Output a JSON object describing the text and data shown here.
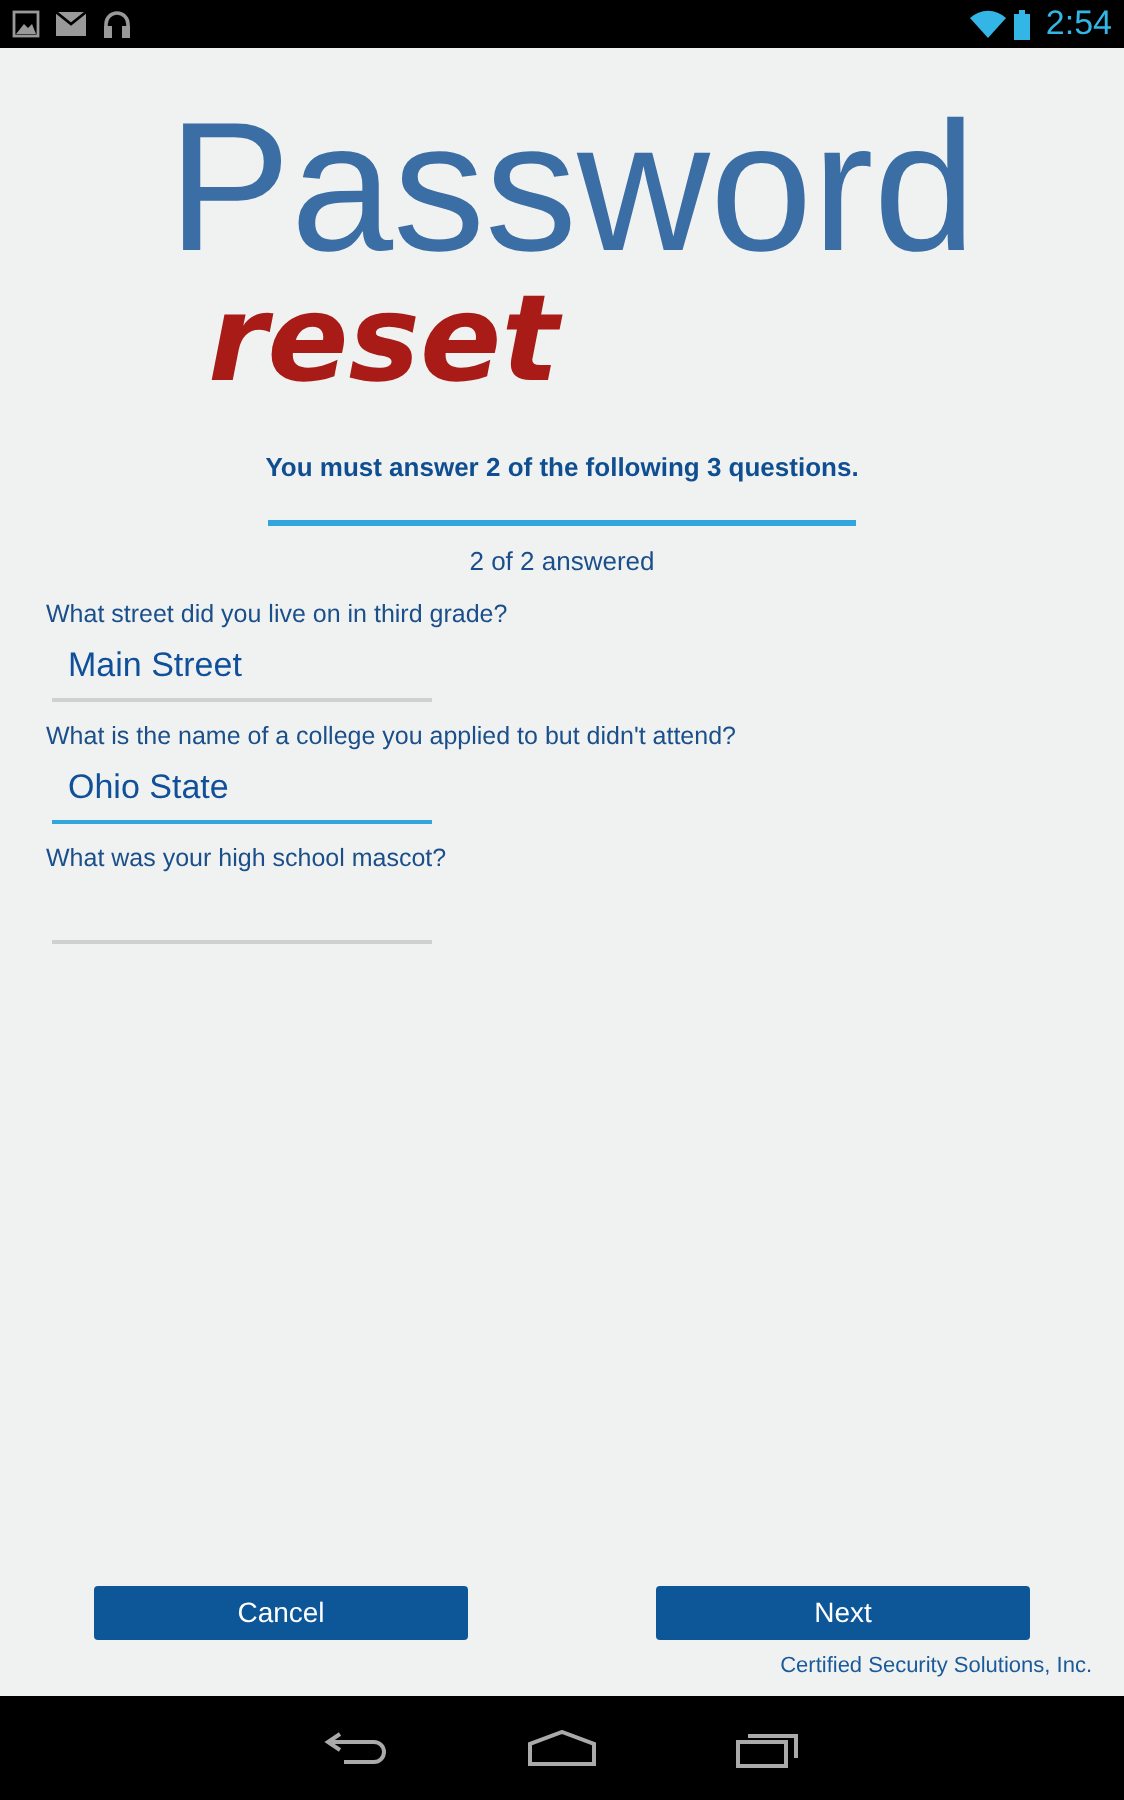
{
  "status_bar": {
    "time": "2:54"
  },
  "logo": {
    "title": "Password",
    "subtitle": "reset"
  },
  "instruction": "You must answer 2 of the following 3 questions.",
  "progress": {
    "level": 1,
    "caption": "2 of 2 answered"
  },
  "questions": [
    {
      "label": "What street did you live on in third grade?",
      "value": "Main Street",
      "focused": false
    },
    {
      "label": "What is the name of a college you applied to but didn't attend?",
      "value": "Ohio State",
      "focused": true
    },
    {
      "label": "What was your high school mascot?",
      "focused": false
    }
  ],
  "buttons": [
    {
      "label": "Cancel"
    },
    {
      "label": "Next"
    }
  ],
  "footer": "Certified Security Solutions, Inc."
}
